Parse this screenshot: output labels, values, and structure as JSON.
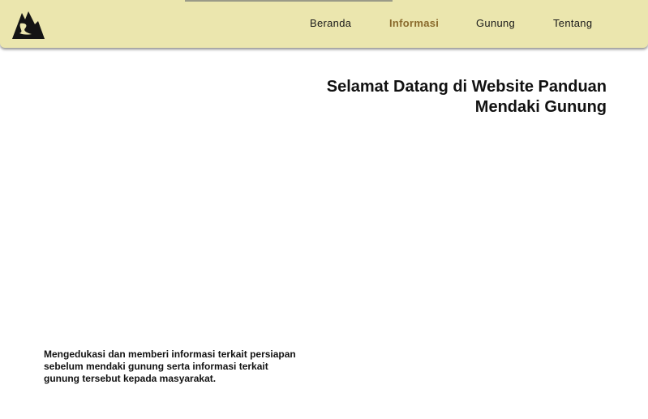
{
  "nav": {
    "logo_icon": "mountain-logo-icon",
    "items": [
      {
        "label": "Beranda",
        "active": false
      },
      {
        "label": "Informasi",
        "active": true
      },
      {
        "label": "Gunung",
        "active": false
      },
      {
        "label": "Tentang",
        "active": false
      }
    ],
    "background_color": "#ebe6ae",
    "active_color": "#8a6a2c"
  },
  "hero": {
    "title": "Selamat Datang di Website Panduan Mendaki Gunung",
    "description": "Mengedukasi dan memberi informasi terkait persiapan sebelum mendaki gunung serta informasi terkait gunung tersebut kepada masyarakat."
  }
}
